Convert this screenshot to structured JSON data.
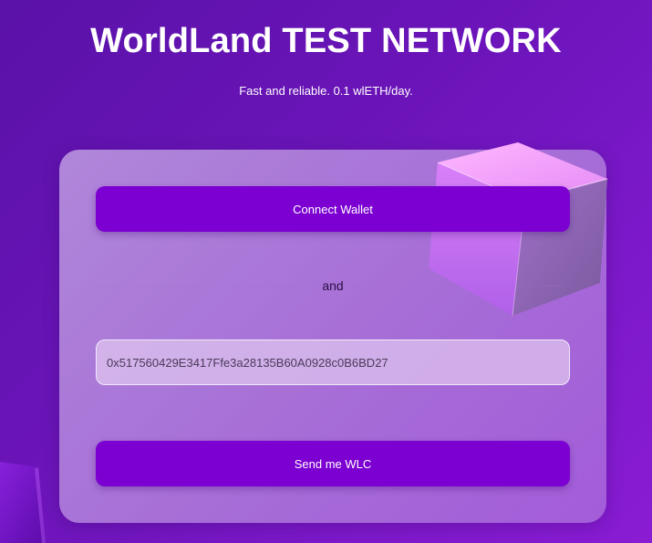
{
  "header": {
    "title": "WorldLand TEST NETWORK",
    "subtitle": "Fast and reliable. 0.1 wlETH/day."
  },
  "form": {
    "connect_label": "Connect Wallet",
    "separator": "and",
    "address_value": "0x517560429E3417Ffe3a28135B60A0928c0B6BD27",
    "send_label": "Send me WLC"
  },
  "colors": {
    "background": "#6a14b8",
    "button": "#7b00d1",
    "card": "#c6a8e6"
  },
  "decor": {
    "cube_icon": "3d-cube-icon",
    "shard_icon": "crystal-shard-icon"
  }
}
